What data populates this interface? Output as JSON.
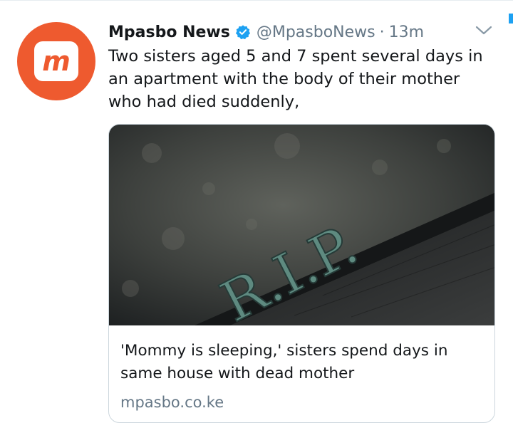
{
  "tweet": {
    "author_name": "Mpasbo News",
    "handle": "@MpasboNews",
    "separator": "·",
    "time": "13m",
    "text": "Two sisters aged 5 and 7 spent several days in an apartment with the body of their mother who had died suddenly,",
    "avatar_logo_text": "m",
    "icons": {
      "verified": "verified-badge-icon",
      "menu": "chevron-down-icon"
    },
    "colors": {
      "avatar_bg": "#ee5a2f",
      "verified": "#1da1f2",
      "secondary_text": "#657786"
    }
  },
  "card": {
    "image_text": "R.I.P.",
    "title": "'Mommy is sleeping,' sisters spend days in same house with dead mother",
    "domain": "mpasbo.co.ke"
  }
}
